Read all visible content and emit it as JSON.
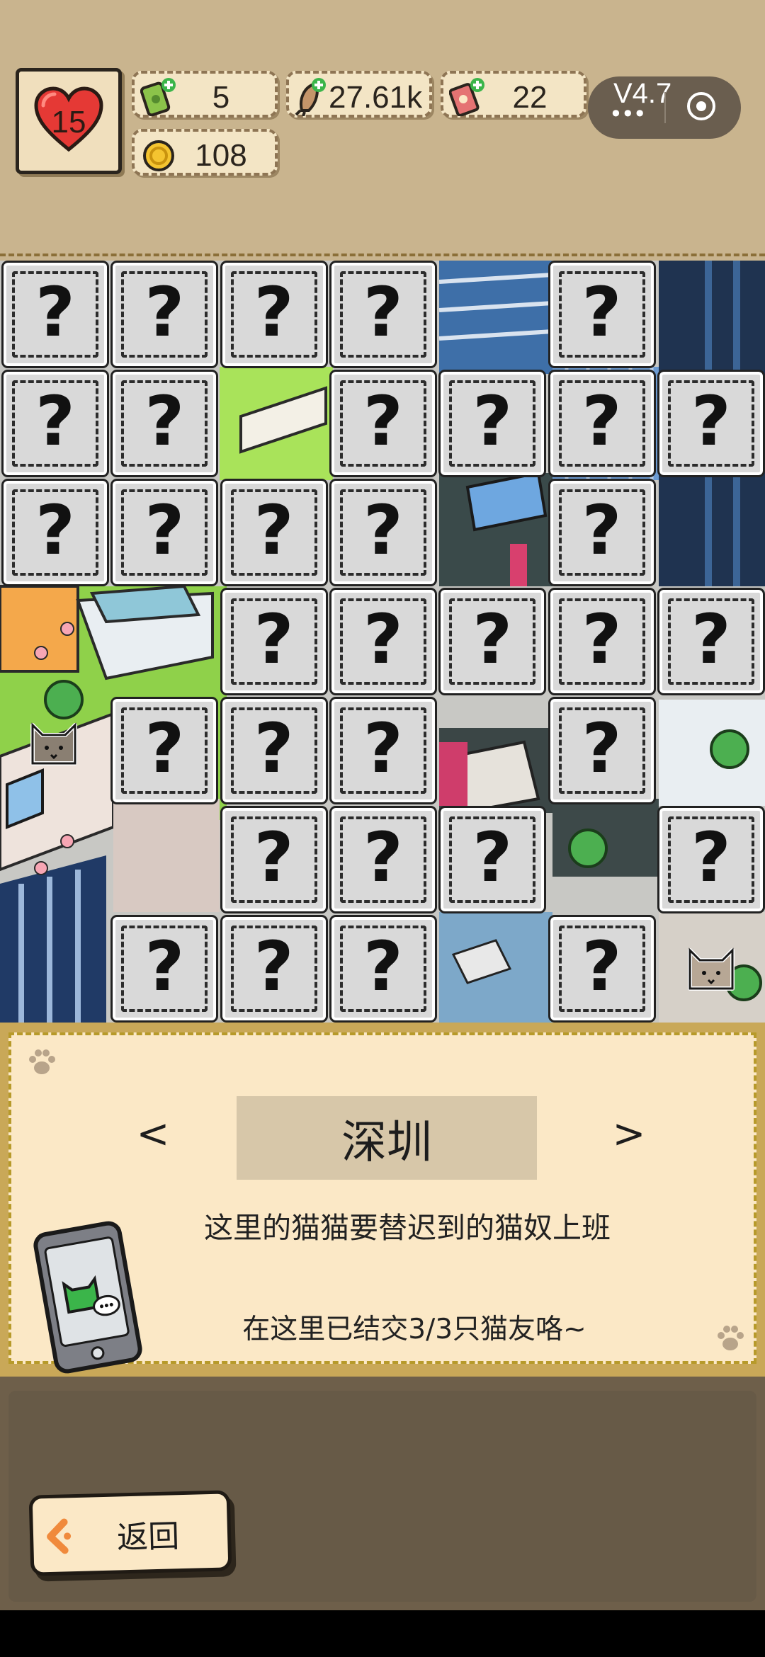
{
  "resources": {
    "lives": "15",
    "cash": "5",
    "fish": "27.61k",
    "cards": "22",
    "coins": "108"
  },
  "capsule": {
    "version": "V4.7"
  },
  "map": {
    "hidden_symbol": "?",
    "icons": [
      "question-mark-tile",
      "cat-head-icon",
      "paw-print-icon"
    ]
  },
  "panel": {
    "prev_label": "<",
    "next_label": ">",
    "city": "深圳",
    "description": "这里的猫猫要替迟到的猫奴上班",
    "progress": "在这里已结交3/3只猫友咯~"
  },
  "back": {
    "label": "返回"
  },
  "colors": {
    "accent_green": "#3bb54a",
    "panel_bg": "#fbe8c6",
    "header_bg": "#c9b48e"
  }
}
